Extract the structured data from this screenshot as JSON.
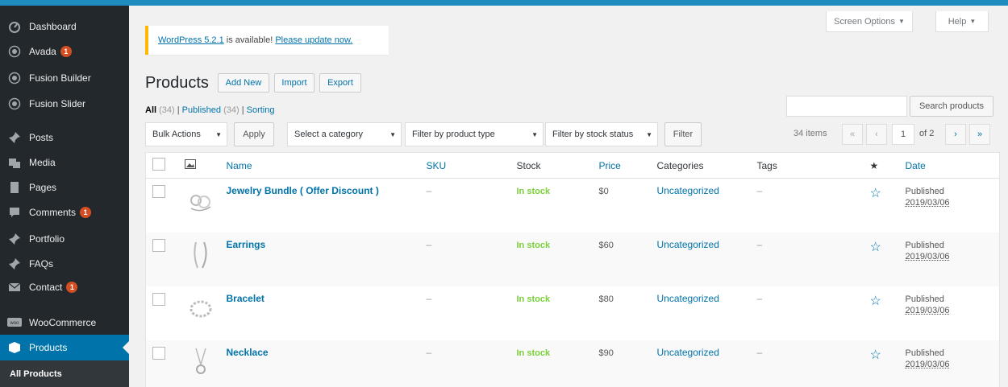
{
  "sidebar": {
    "items": [
      {
        "label": "Dashboard",
        "icon": "dashboard-icon"
      },
      {
        "label": "Avada",
        "icon": "avada-icon",
        "badge": "1"
      },
      {
        "label": "Fusion Builder",
        "icon": "fusion-builder-icon"
      },
      {
        "label": "Fusion Slider",
        "icon": "fusion-slider-icon"
      },
      {
        "label": "Posts",
        "icon": "pin-icon"
      },
      {
        "label": "Media",
        "icon": "media-icon"
      },
      {
        "label": "Pages",
        "icon": "pages-icon"
      },
      {
        "label": "Comments",
        "icon": "comments-icon",
        "badge": "1"
      },
      {
        "label": "Portfolio",
        "icon": "pin-icon"
      },
      {
        "label": "FAQs",
        "icon": "pin-icon"
      },
      {
        "label": "Contact",
        "icon": "mail-icon",
        "badge": "1"
      },
      {
        "label": "WooCommerce",
        "icon": "woocommerce-icon"
      },
      {
        "label": "Products",
        "icon": "products-icon"
      }
    ],
    "submenu_label": "All Products"
  },
  "header": {
    "screen_options": "Screen Options",
    "help": "Help"
  },
  "notice": {
    "version_link": "WordPress 5.2.1",
    "text": " is available! ",
    "update_link": "Please update now."
  },
  "page": {
    "title": "Products",
    "add_new": "Add New",
    "import": "Import",
    "export": "Export"
  },
  "filters": {
    "all": "All",
    "all_count": "(34)",
    "published": "Published",
    "published_count": "(34)",
    "sorting": "Sorting",
    "sep": "|",
    "search_button": "Search products",
    "bulk_actions": "Bulk Actions",
    "apply": "Apply",
    "category": "Select a category",
    "product_type": "Filter by product type",
    "stock_status": "Filter by stock status",
    "filter": "Filter",
    "items_count": "34 items",
    "current_page": "1",
    "of_pages": "of 2"
  },
  "pagination": {
    "first": "«",
    "prev": "‹",
    "next": "›",
    "last": "»"
  },
  "table": {
    "headers": {
      "name": "Name",
      "sku": "SKU",
      "stock": "Stock",
      "price": "Price",
      "categories": "Categories",
      "tags": "Tags",
      "date": "Date"
    },
    "rows": [
      {
        "name": "Jewelry Bundle ( Offer Discount )",
        "sku": "–",
        "stock": "In stock",
        "price": "$0",
        "category": "Uncategorized",
        "tags": "–",
        "status": "Published",
        "date": "2019/03/06",
        "thumb": "bundle"
      },
      {
        "name": "Earrings",
        "sku": "–",
        "stock": "In stock",
        "price": "$60",
        "category": "Uncategorized",
        "tags": "–",
        "status": "Published",
        "date": "2019/03/06",
        "thumb": "earrings"
      },
      {
        "name": "Bracelet",
        "sku": "–",
        "stock": "In stock",
        "price": "$80",
        "category": "Uncategorized",
        "tags": "–",
        "status": "Published",
        "date": "2019/03/06",
        "thumb": "bracelet"
      },
      {
        "name": "Necklace",
        "sku": "–",
        "stock": "In stock",
        "price": "$90",
        "category": "Uncategorized",
        "tags": "–",
        "status": "Published",
        "date": "2019/03/06",
        "thumb": "necklace"
      }
    ]
  },
  "colors": {
    "sidebar_bg": "#23282d",
    "accent": "#0073aa",
    "in_stock": "#7ad03a",
    "badge": "#d54e21",
    "notice_border": "#ffb900"
  }
}
